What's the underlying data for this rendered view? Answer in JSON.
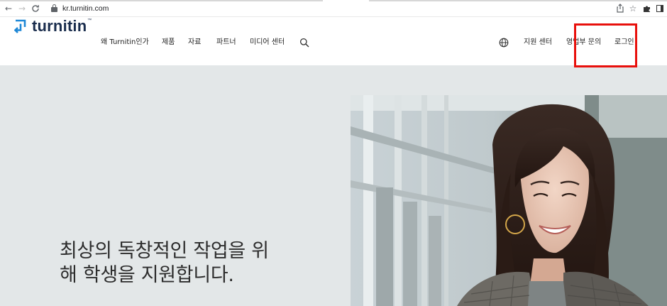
{
  "browser": {
    "url": "kr.turnitin.com",
    "icons": [
      "back-icon",
      "forward-icon",
      "reload-icon",
      "lock-icon",
      "share-icon",
      "star-icon",
      "puzzle-icon",
      "side-panel-icon"
    ]
  },
  "header": {
    "logo_text": "turnitin",
    "nav_left": [
      "왜 Turnitin인가",
      "제품",
      "자료",
      "파트너",
      "미디어 센터"
    ],
    "nav_right": [
      "지원 센터",
      "영업부 문의",
      "로그인"
    ],
    "icons": [
      "search-icon",
      "globe-icon"
    ]
  },
  "hero": {
    "title_line1": "최상의 독창적인 작업을 위",
    "title_line2": "해 학생을 지원합니다."
  },
  "annotation": {
    "highlight_color": "#e8100c"
  },
  "colors": {
    "brand_navy": "#1a2d4d",
    "brand_blue": "#1d87d6",
    "hero_background": "#e3e7e8"
  }
}
